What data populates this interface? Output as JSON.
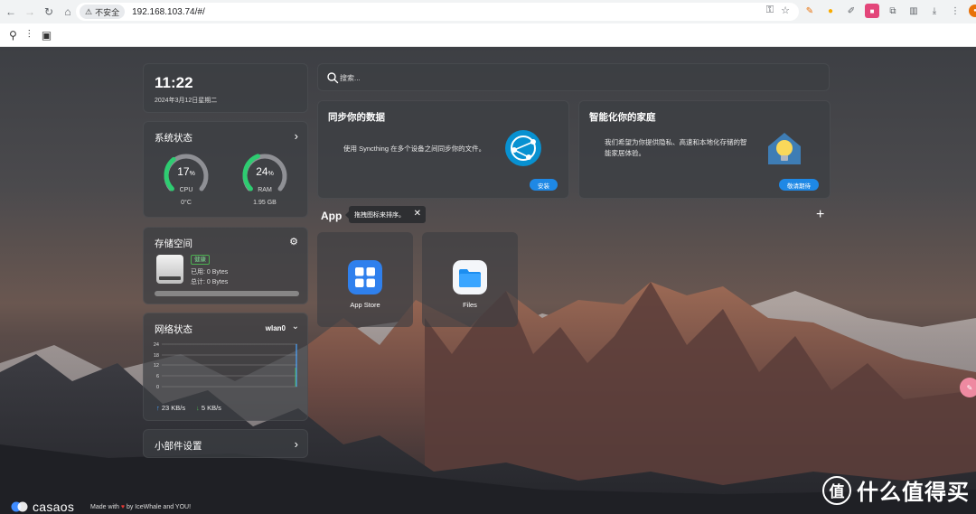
{
  "browser": {
    "security_label": "不安全",
    "url": "192.168.103.74/#/"
  },
  "clock": {
    "time": "11:22",
    "date": "2024年3月12日星期二"
  },
  "system": {
    "title": "系统状态",
    "cpu": {
      "value": "17",
      "unit": "%",
      "label": "CPU",
      "sub": "0°C",
      "percent": 17,
      "color": "#2ecc71"
    },
    "ram": {
      "value": "24",
      "unit": "%",
      "label": "RAM",
      "sub": "1.95 GB",
      "percent": 24,
      "color": "#2ecc71"
    }
  },
  "storage": {
    "title": "存储空间",
    "status": "健康",
    "used": "已用: 0 Bytes",
    "total": "总计: 0 Bytes"
  },
  "network": {
    "title": "网络状态",
    "interface": "wlan0",
    "y_ticks": [
      "24",
      "18",
      "12",
      "6",
      "0"
    ],
    "upload": "23 KB/s",
    "download": "5 KB/s"
  },
  "widgets": {
    "title": "小部件设置"
  },
  "search": {
    "placeholder": "搜索..."
  },
  "feature_sync": {
    "title": "同步你的数据",
    "desc": "使用 Syncthing 在多个设备之间同步你的文件。",
    "button": "安装"
  },
  "feature_home": {
    "title": "智能化你的家庭",
    "desc_line1": "我们希望为你提供隐私、高速和本地化存储的智",
    "desc_line2": "能家居体验。",
    "button": "敬请期待"
  },
  "apps": {
    "title": "App",
    "tooltip": "拖拽图标来排序。",
    "items": [
      {
        "label": "App Store",
        "icon": "app-store-icon"
      },
      {
        "label": "Files",
        "icon": "files-icon"
      }
    ]
  },
  "footer": {
    "brand": "casaos",
    "made_prefix": "Made with",
    "made_suffix": "by IceWhale and YOU!"
  },
  "watermark": {
    "glyph": "值",
    "text": "什么值得买"
  },
  "colors": {
    "accent": "#1e88e5",
    "healthy": "#4caf50",
    "upload": "#4aa3ff",
    "download": "#4caf50"
  }
}
